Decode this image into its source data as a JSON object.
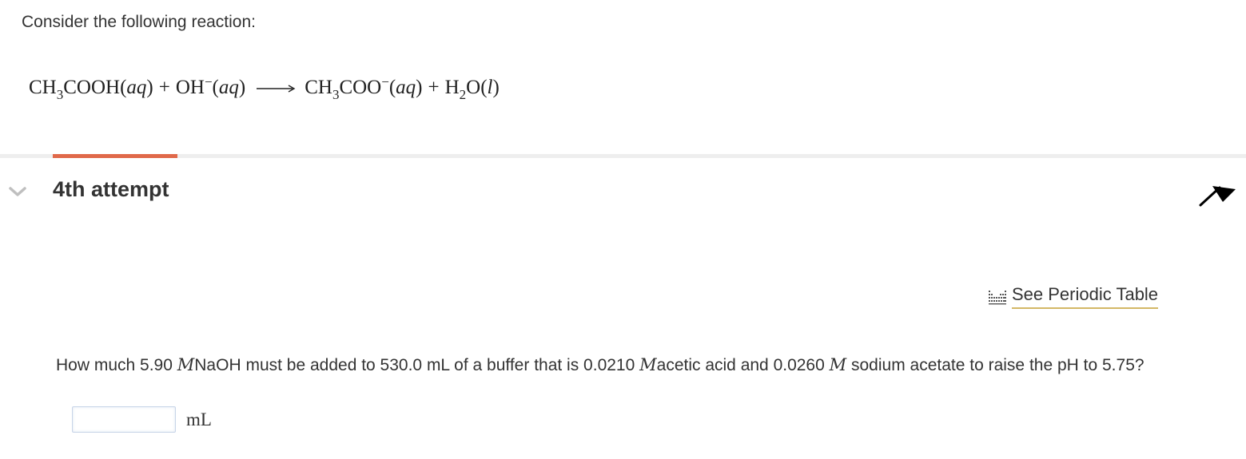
{
  "intro_text": "Consider the following reaction:",
  "equation": {
    "reactant1": {
      "main": "CH",
      "sub": "3",
      "rest": "COOH",
      "state": "aq"
    },
    "plus1": "+",
    "reactant2": {
      "main": "OH",
      "charge": "−",
      "state": "aq"
    },
    "product1": {
      "main": "CH",
      "sub": "3",
      "rest": "COO",
      "charge": "−",
      "state": "aq"
    },
    "plus2": "+",
    "product2": {
      "main": "H",
      "sub": "2",
      "rest": "O",
      "state": "l"
    }
  },
  "attempt": {
    "title": "4th attempt",
    "progress_fraction": 0.1
  },
  "periodic_table_link": "See Periodic Table",
  "question": {
    "p1": "How much 5.90 ",
    "unit_m": "M",
    "p2": "NaOH must be added to 530.0 mL of a buffer that is 0.0210 ",
    "p3": "acetic acid and 0.0260 ",
    "p4": " sodium acetate to raise the pH to 5.75?"
  },
  "answer": {
    "value": "",
    "placeholder": "",
    "unit": "mL"
  },
  "colors": {
    "accent": "#e0694a",
    "link_underline": "#d4b866"
  }
}
